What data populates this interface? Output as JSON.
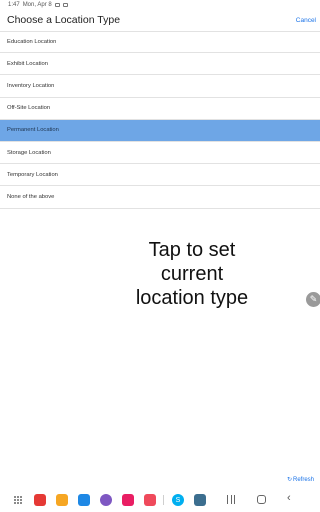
{
  "status_bar": {
    "time": "1:47",
    "date": "Mon, Apr 8"
  },
  "header": {
    "title": "Choose a Location Type",
    "cancel_label": "Cancel"
  },
  "location_types": [
    {
      "label": "Education Location",
      "selected": false
    },
    {
      "label": "Exhibit Location",
      "selected": false
    },
    {
      "label": "Inventory Location",
      "selected": false
    },
    {
      "label": "Off-Site Location",
      "selected": false
    },
    {
      "label": "Permanent Location",
      "selected": true
    },
    {
      "label": "Storage Location",
      "selected": false
    },
    {
      "label": "Temporary Location",
      "selected": false
    },
    {
      "label": "None of the above",
      "selected": false
    }
  ],
  "hint": {
    "line1": "Tap to set",
    "line2": "current",
    "line3": "location type"
  },
  "refresh": {
    "label": "Refresh",
    "icon": "refresh-icon"
  },
  "edit_fab": {
    "icon": "pencil-icon"
  },
  "colors": {
    "accent": "#1a73e8",
    "selected_row": "#6ea6e6"
  },
  "nav_bar": {
    "apps": [
      {
        "name": "app-icon-red",
        "color": "#e53935"
      },
      {
        "name": "app-icon-yellow",
        "color": "#f6a623"
      },
      {
        "name": "app-icon-blue-square",
        "color": "#1e88e5"
      },
      {
        "name": "app-icon-purple",
        "color": "#7e57c2"
      },
      {
        "name": "app-icon-pink-flower",
        "color": "#e91e63"
      },
      {
        "name": "app-icon-red-camera",
        "color": "#ef4a5b"
      },
      {
        "name": "app-icon-skype",
        "color": "#00aff0"
      },
      {
        "name": "app-icon-android",
        "color": "#3c6e8f"
      }
    ]
  }
}
